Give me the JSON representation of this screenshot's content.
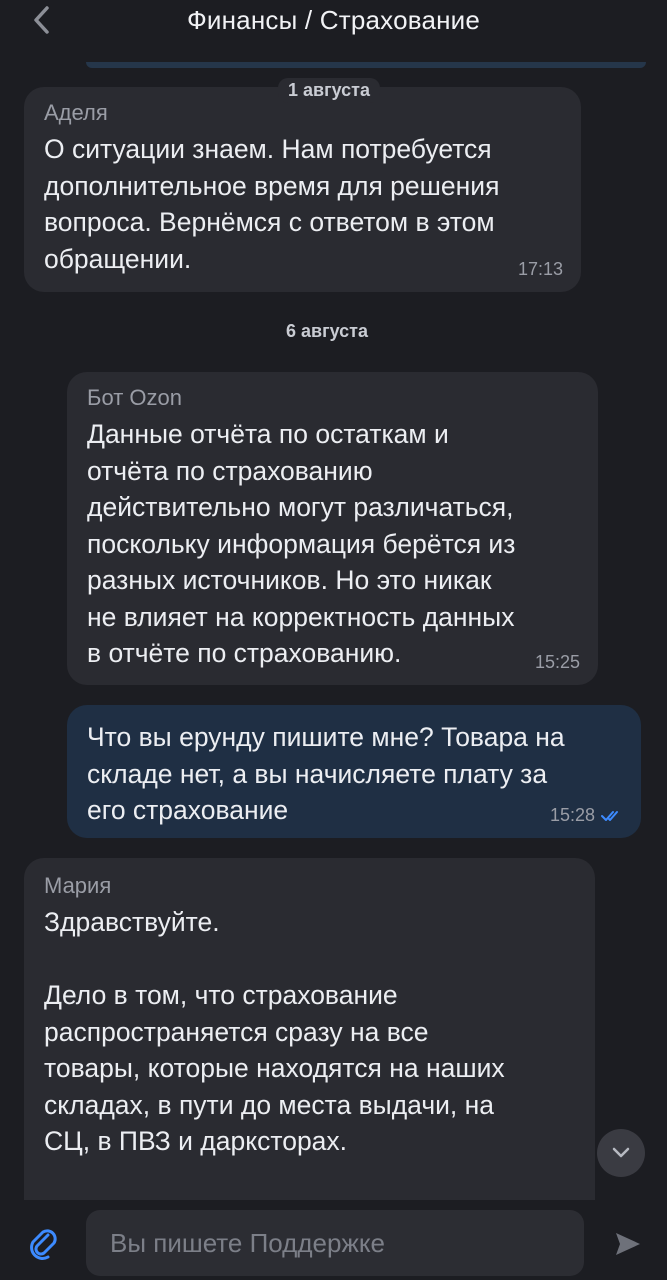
{
  "header": {
    "title": "Финансы / Страхование"
  },
  "dates": {
    "aug1": "1 августа",
    "aug6": "6 августа"
  },
  "messages": [
    {
      "author": "Аделя",
      "text": "О ситуации знаем. Нам потребуется\nдополнительное время для решения\nвопроса. Вернёмся с ответом в этом\nобращении.",
      "time": "17:13"
    },
    {
      "author": "Бот Ozon",
      "text": "Данные отчёта по остаткам и\nотчёта по страхованию\nдействительно могут различаться,\nпоскольку информация берётся из\nразных источников. Но это никак\nне влияет на корректность данных\nв отчёте по страхованию.",
      "time": "15:25"
    },
    {
      "text": "Что вы ерунду пишите мне? Товара на\nскладе нет, а вы начисляете плату за\nего страхование",
      "time": "15:28"
    },
    {
      "author": "Мария",
      "text": "Здравствуйте.\n\nДело в том, что страхование\nраспространяется сразу на все\nтовары, которые находятся на наших\nскладах, в пути до места выдачи, на\nСЦ, в ПВЗ и даркстора​х."
    }
  ],
  "input": {
    "placeholder": "Вы пишете Поддержке"
  },
  "icons": {
    "back": "chevron-left-icon",
    "scroll_down": "chevron-down-icon",
    "attach": "paperclip-icon",
    "send": "send-icon",
    "read": "double-check-icon"
  },
  "colors": {
    "background": "#1c1d22",
    "incoming_bubble": "#2a2b31",
    "outgoing_bubble": "#1f2f44",
    "accent": "#3d8bff"
  }
}
